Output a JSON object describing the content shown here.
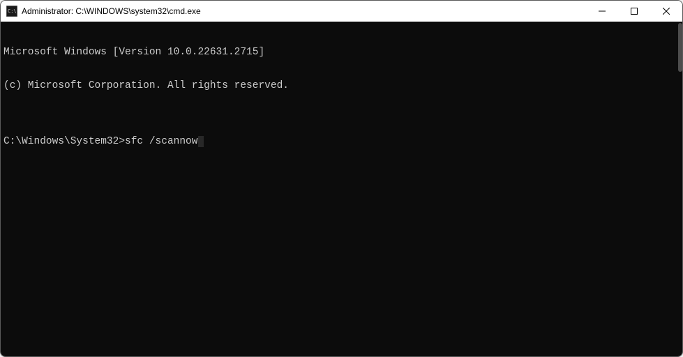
{
  "titlebar": {
    "title": "Administrator: C:\\WINDOWS\\system32\\cmd.exe"
  },
  "terminal": {
    "line1": "Microsoft Windows [Version 10.0.22631.2715]",
    "line2": "(c) Microsoft Corporation. All rights reserved.",
    "blank": "",
    "prompt": "C:\\Windows\\System32>",
    "command": "sfc /scannow"
  }
}
